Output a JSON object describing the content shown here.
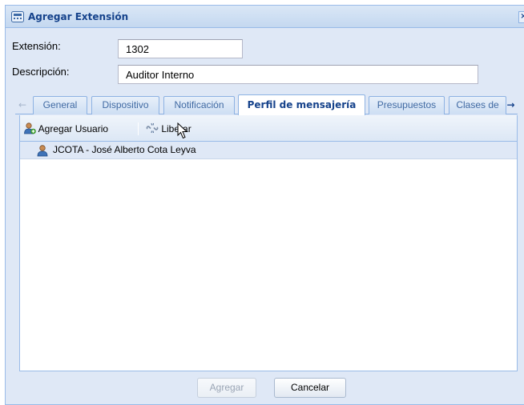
{
  "window": {
    "title": "Agregar Extensión",
    "close_glyph": "×",
    "title_icon": "phone-icon"
  },
  "form": {
    "extension_label": "Extensión:",
    "extension_value": "1302",
    "description_label": "Descripción:",
    "description_value": "Auditor Interno"
  },
  "tabs": {
    "scroll_left_glyph": "←",
    "scroll_right_glyph": "→",
    "items": [
      {
        "label": "General"
      },
      {
        "label": "Dispositivo"
      },
      {
        "label": "Notificación"
      },
      {
        "label": "Perfil de mensajería",
        "active": true
      },
      {
        "label": "Presupuestos"
      },
      {
        "label": "Clases de"
      }
    ]
  },
  "toolbar": {
    "add_user_label": "Agregar Usuario",
    "release_label": "Liberar"
  },
  "list": {
    "rows": [
      {
        "label": "JCOTA - José Alberto Cota Leyva",
        "icon": "user-icon"
      }
    ]
  },
  "footer": {
    "add_label": "Agregar",
    "cancel_label": "Cancelar"
  },
  "colors": {
    "accent": "#15428b",
    "border": "#99bbe8",
    "panel_bg": "#dfe8f6"
  }
}
